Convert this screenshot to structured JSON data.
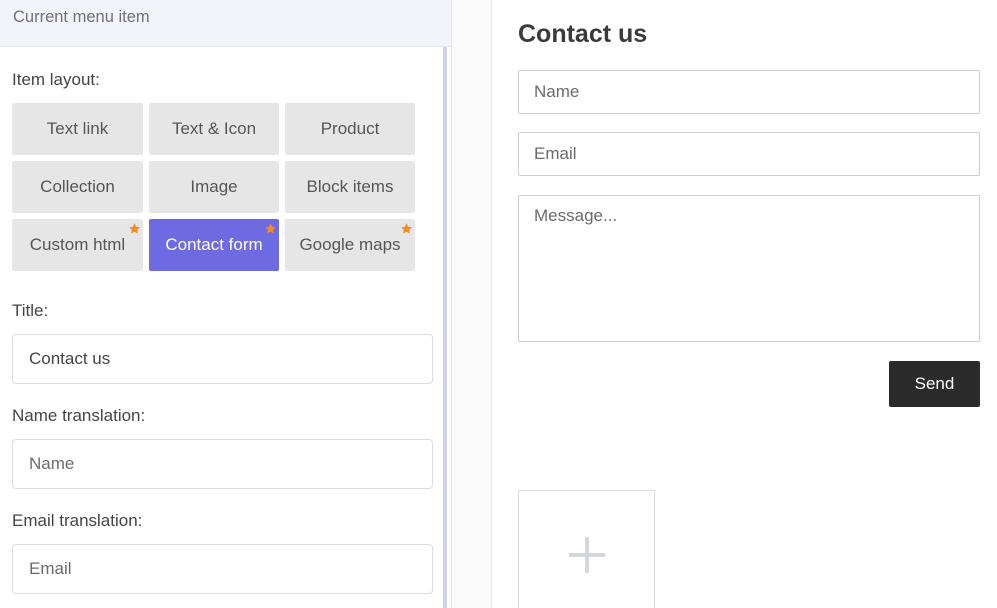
{
  "panel": {
    "header": "Current menu item",
    "item_layout_label": "Item layout:",
    "layouts": [
      {
        "label": "Text link",
        "starred": false,
        "active": false
      },
      {
        "label": "Text & Icon",
        "starred": false,
        "active": false
      },
      {
        "label": "Product",
        "starred": false,
        "active": false
      },
      {
        "label": "Collection",
        "starred": false,
        "active": false
      },
      {
        "label": "Image",
        "starred": false,
        "active": false
      },
      {
        "label": "Block items",
        "starred": false,
        "active": false
      },
      {
        "label": "Custom html",
        "starred": true,
        "active": false
      },
      {
        "label": "Contact form",
        "starred": true,
        "active": true
      },
      {
        "label": "Google maps",
        "starred": true,
        "active": false
      }
    ],
    "title_label": "Title:",
    "title_value": "Contact us",
    "name_translation_label": "Name translation:",
    "name_translation_placeholder": "Name",
    "email_translation_label": "Email translation:",
    "email_translation_placeholder": "Email"
  },
  "preview": {
    "title": "Contact us",
    "name_placeholder": "Name",
    "email_placeholder": "Email",
    "message_placeholder": "Message...",
    "send_label": "Send"
  },
  "colors": {
    "accent": "#6d6ae2",
    "star": "#f58a1f",
    "send_button": "#2b2b2b"
  },
  "icons": {
    "star": "star-icon",
    "add": "plus-icon"
  }
}
